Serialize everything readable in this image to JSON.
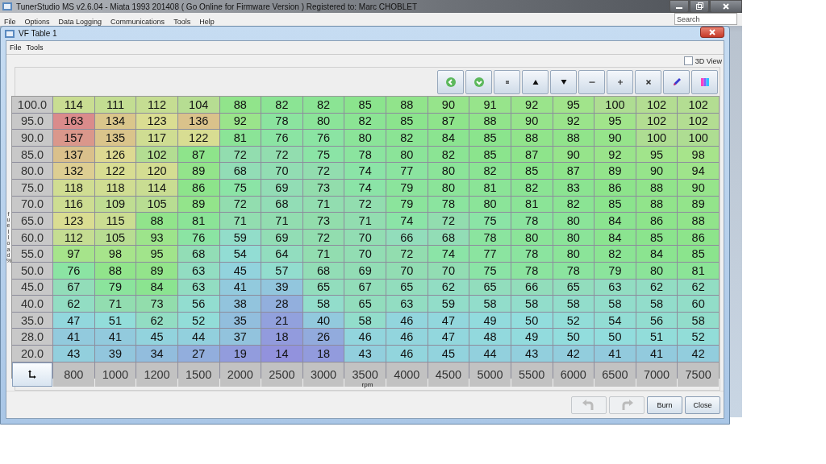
{
  "app_window": {
    "title": "TunerStudio MS v2.6.04 - Miata 1993 201408 ( Go Online for Firmware Version ) Registered to: Marc CHOBLET",
    "menu": [
      "File",
      "Options",
      "Data Logging",
      "Communications",
      "Tools",
      "Help"
    ],
    "search": {
      "placeholder": "Search"
    }
  },
  "dialog": {
    "title": "VF Table 1",
    "menu": [
      "File",
      "Tools"
    ],
    "view_3d": {
      "label": "3D View",
      "checked": false
    },
    "table": {
      "y_axis_label": "fuel load %",
      "x_axis_label": "rpm",
      "x_bins": [
        "800",
        "1000",
        "1200",
        "1500",
        "2000",
        "2500",
        "3000",
        "3500",
        "4000",
        "4500",
        "5000",
        "5500",
        "6000",
        "6500",
        "7000",
        "7500"
      ],
      "rows": [
        {
          "load": "100.0",
          "values": [
            "114",
            "111",
            "112",
            "104",
            "88",
            "82",
            "82",
            "85",
            "88",
            "90",
            "91",
            "92",
            "95",
            "100",
            "102",
            "102"
          ]
        },
        {
          "load": "95.0",
          "values": [
            "163",
            "134",
            "123",
            "136",
            "92",
            "78",
            "80",
            "82",
            "85",
            "87",
            "88",
            "90",
            "92",
            "95",
            "102",
            "102"
          ]
        },
        {
          "load": "90.0",
          "values": [
            "157",
            "135",
            "117",
            "122",
            "81",
            "76",
            "76",
            "80",
            "82",
            "84",
            "85",
            "88",
            "88",
            "90",
            "100",
            "100"
          ]
        },
        {
          "load": "85.0",
          "values": [
            "137",
            "126",
            "102",
            "87",
            "72",
            "72",
            "75",
            "78",
            "80",
            "82",
            "85",
            "87",
            "90",
            "92",
            "95",
            "98"
          ]
        },
        {
          "load": "80.0",
          "values": [
            "132",
            "122",
            "120",
            "89",
            "68",
            "70",
            "72",
            "74",
            "77",
            "80",
            "82",
            "85",
            "87",
            "89",
            "90",
            "94"
          ]
        },
        {
          "load": "75.0",
          "values": [
            "118",
            "118",
            "114",
            "86",
            "75",
            "69",
            "73",
            "74",
            "79",
            "80",
            "81",
            "82",
            "83",
            "86",
            "88",
            "90"
          ]
        },
        {
          "load": "70.0",
          "values": [
            "116",
            "109",
            "105",
            "89",
            "72",
            "68",
            "71",
            "72",
            "79",
            "78",
            "80",
            "81",
            "82",
            "85",
            "88",
            "89"
          ]
        },
        {
          "load": "65.0",
          "values": [
            "123",
            "115",
            "88",
            "81",
            "71",
            "71",
            "73",
            "71",
            "74",
            "72",
            "75",
            "78",
            "80",
            "84",
            "86",
            "88"
          ]
        },
        {
          "load": "60.0",
          "values": [
            "112",
            "105",
            "93",
            "76",
            "59",
            "69",
            "72",
            "70",
            "66",
            "68",
            "78",
            "80",
            "80",
            "84",
            "85",
            "86"
          ]
        },
        {
          "load": "55.0",
          "values": [
            "97",
            "98",
            "95",
            "68",
            "54",
            "64",
            "71",
            "70",
            "72",
            "74",
            "77",
            "78",
            "80",
            "82",
            "84",
            "85"
          ]
        },
        {
          "load": "50.0",
          "values": [
            "76",
            "88",
            "89",
            "63",
            "45",
            "57",
            "68",
            "69",
            "70",
            "70",
            "75",
            "78",
            "78",
            "79",
            "80",
            "81"
          ]
        },
        {
          "load": "45.0",
          "values": [
            "67",
            "79",
            "84",
            "63",
            "41",
            "39",
            "65",
            "67",
            "65",
            "62",
            "65",
            "66",
            "65",
            "63",
            "62",
            "62"
          ]
        },
        {
          "load": "40.0",
          "values": [
            "62",
            "71",
            "73",
            "56",
            "38",
            "28",
            "58",
            "65",
            "63",
            "59",
            "58",
            "58",
            "58",
            "58",
            "58",
            "60"
          ]
        },
        {
          "load": "35.0",
          "values": [
            "47",
            "51",
            "62",
            "52",
            "35",
            "21",
            "40",
            "58",
            "46",
            "47",
            "49",
            "50",
            "52",
            "54",
            "56",
            "58"
          ]
        },
        {
          "load": "28.0",
          "values": [
            "41",
            "41",
            "45",
            "44",
            "37",
            "18",
            "26",
            "46",
            "46",
            "47",
            "48",
            "49",
            "50",
            "50",
            "51",
            "52"
          ]
        },
        {
          "load": "20.0",
          "values": [
            "43",
            "39",
            "34",
            "27",
            "19",
            "14",
            "18",
            "43",
            "46",
            "45",
            "44",
            "43",
            "42",
            "41",
            "41",
            "42"
          ]
        }
      ]
    },
    "history_buttons": [
      {
        "kind": "undo",
        "disabled": true
      },
      {
        "kind": "redo",
        "disabled": true
      }
    ],
    "buttons": [
      {
        "label": "Burn",
        "disabled": false
      },
      {
        "label": "Close",
        "disabled": false
      }
    ]
  }
}
